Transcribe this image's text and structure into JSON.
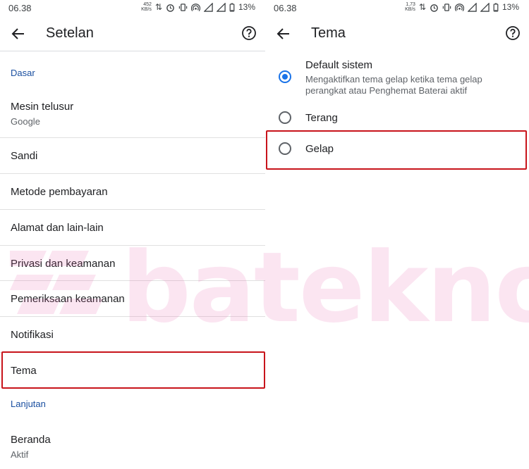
{
  "status_left": {
    "time": "06.38",
    "speed": "452",
    "speed_unit": "KB/s",
    "battery": "13%"
  },
  "status_right": {
    "time": "06.38",
    "speed": "1,73",
    "speed_unit": "KB/s",
    "battery": "13%"
  },
  "settings_screen": {
    "title": "Setelan",
    "sections": [
      {
        "header": "Dasar"
      },
      {
        "header": "Lanjutan"
      }
    ],
    "items": [
      {
        "title": "Mesin telusur",
        "subtitle": "Google"
      },
      {
        "title": "Sandi"
      },
      {
        "title": "Metode pembayaran"
      },
      {
        "title": "Alamat dan lain-lain"
      },
      {
        "title": "Privasi dan keamanan"
      },
      {
        "title": "Pemeriksaan keamanan"
      },
      {
        "title": "Notifikasi"
      },
      {
        "title": "Tema"
      },
      {
        "title": "Beranda",
        "subtitle": "Aktif"
      }
    ]
  },
  "theme_screen": {
    "title": "Tema",
    "options": [
      {
        "label": "Default sistem",
        "description": "Mengaktifkan tema gelap ketika tema gelap perangkat atau Penghemat Baterai aktif",
        "selected": true
      },
      {
        "label": "Terang",
        "selected": false
      },
      {
        "label": "Gelap",
        "selected": false
      }
    ]
  },
  "watermark": {
    "text": "batekno"
  },
  "colors": {
    "accent_blue": "#1a73e8",
    "section_blue": "#1a4fa0",
    "highlight_red": "#c8141b",
    "watermark_pink": "#e75caa"
  },
  "icons": [
    "back-arrow-icon",
    "help-icon",
    "radio-checked-icon",
    "radio-unchecked-icon",
    "alarm-icon",
    "vibrate-icon",
    "hotspot-icon",
    "signal-icon",
    "battery-icon"
  ]
}
